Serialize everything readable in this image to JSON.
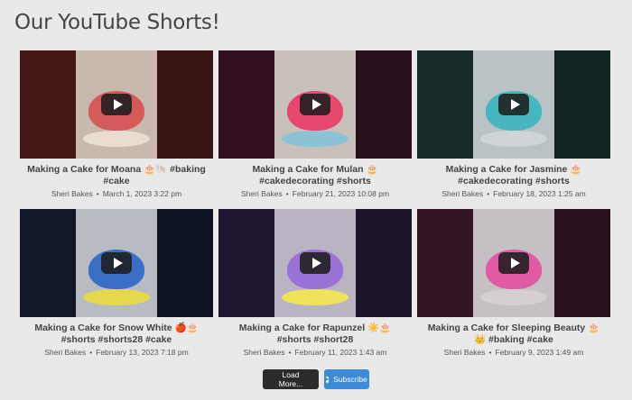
{
  "page_title": "Our YouTube Shorts!",
  "videos": [
    {
      "title": "Making a Cake for Moana 🎂🐚 #baking #cake",
      "channel": "Sheri Bakes",
      "date": "March 1, 2023 3:22 pm",
      "colors": {
        "side": "#7a2b2a",
        "bg": "#c9b8ae",
        "cake": "#d45b5a",
        "base": "#e8ddd0"
      }
    },
    {
      "title": "Making a Cake for Mulan 🎂 #cakedecorating #shorts",
      "channel": "Sheri Bakes",
      "date": "February 21, 2023 10:08 pm",
      "colors": {
        "side": "#5b1f3c",
        "bg": "#c8c0bb",
        "cake": "#e6476f",
        "base": "#8ac3d6"
      }
    },
    {
      "title": "Making a Cake for Jasmine 🎂 #cakedecorating #shorts",
      "channel": "Sheri Bakes",
      "date": "February 18, 2023 1:25 am",
      "colors": {
        "side": "#2b4e4e",
        "bg": "#b9c2c4",
        "cake": "#47b7bf",
        "base": "#cfd4d6"
      }
    },
    {
      "title": "Making a Cake for Snow White 🍎🎂 #shorts #shorts28 #cake",
      "channel": "Sheri Bakes",
      "date": "February 13, 2023 7:18 pm",
      "colors": {
        "side": "#1d2a4a",
        "bg": "#b8bcc2",
        "cake": "#3a6fc5",
        "base": "#e5d84c"
      }
    },
    {
      "title": "Making a Cake for Rapunzel ☀️🎂 #shorts #short28",
      "channel": "Sheri Bakes",
      "date": "February 11, 2023 1:43 am",
      "colors": {
        "side": "#3b2a5a",
        "bg": "#b9b3c2",
        "cake": "#9a72d6",
        "base": "#f0e25a"
      }
    },
    {
      "title": "Making a Cake for Sleeping Beauty 🎂👑 #baking #cake",
      "channel": "Sheri Bakes",
      "date": "February 9, 2023 1:49 am",
      "colors": {
        "side": "#5c2440",
        "bg": "#c6bfc4",
        "cake": "#e05aa4",
        "base": "#d5cfd2"
      }
    }
  ],
  "buttons": {
    "load_more": "Load More...",
    "subscribe": "Subscribe"
  }
}
